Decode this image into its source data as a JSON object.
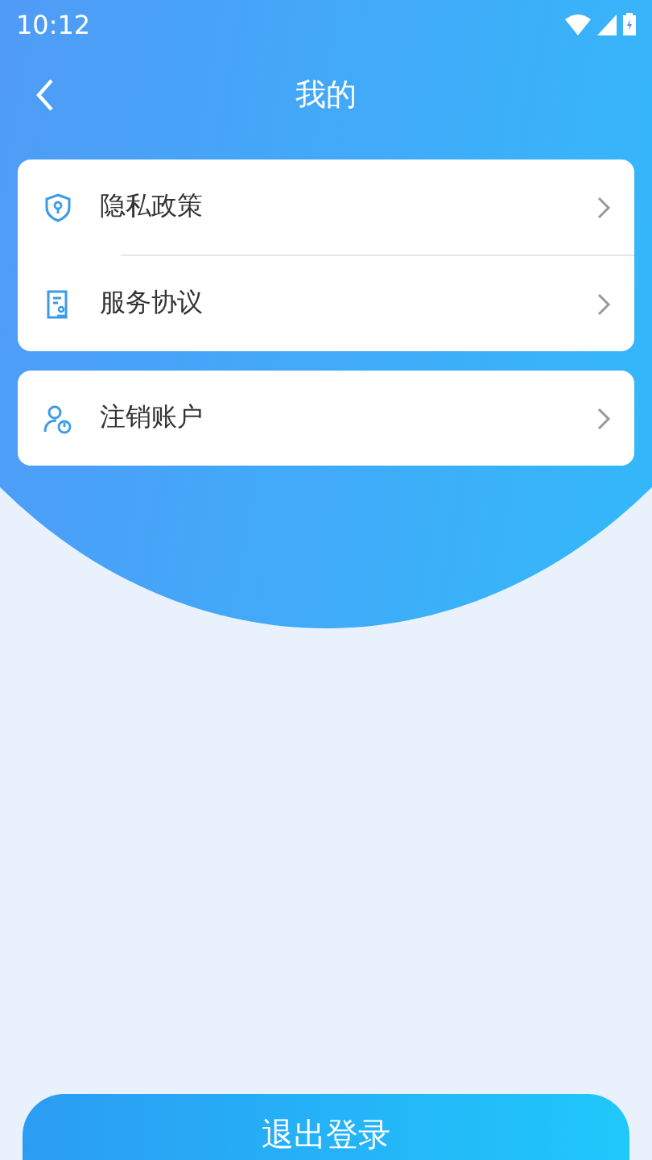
{
  "status_bar": {
    "time": "10:12"
  },
  "nav": {
    "title": "我的"
  },
  "groups": [
    {
      "items": [
        {
          "label": "隐私政策"
        },
        {
          "label": "服务协议"
        }
      ]
    },
    {
      "items": [
        {
          "label": "注销账户"
        }
      ]
    }
  ],
  "logout_button": {
    "label": "退出登录"
  }
}
